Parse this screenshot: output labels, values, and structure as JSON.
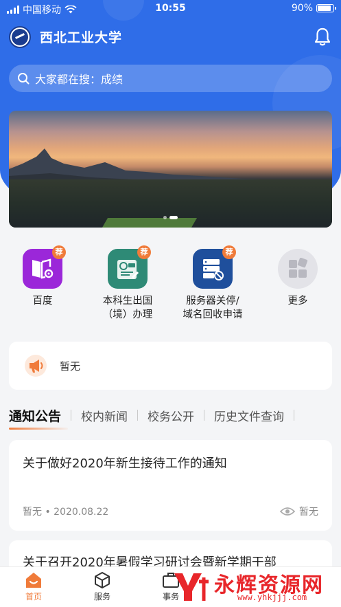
{
  "status_bar": {
    "carrier": "中国移动",
    "time": "10:55",
    "battery": "90%"
  },
  "header": {
    "title": "西北工业大学"
  },
  "search": {
    "text": "大家都在搜：成绩"
  },
  "services": [
    {
      "label": "百度",
      "badge": "荐",
      "icon": "book-gear-icon",
      "color": "#9b27d9"
    },
    {
      "label": "本科生出国（境）办理",
      "badge": "荐",
      "icon": "document-form-icon",
      "color": "#2e8a76"
    },
    {
      "label": "服务器关停/\n域名回收申请",
      "badge": "荐",
      "icon": "server-stop-icon",
      "color": "#1f4f9c"
    },
    {
      "label": "更多",
      "icon": "grid-more-icon",
      "color": "#e3e3e8"
    }
  ],
  "service_labels": {
    "s1": "百度",
    "s2_line1": "本科生出国",
    "s2_line2": "（境）办理",
    "s3_line1": "服务器关停/",
    "s3_line2": "域名回收申请",
    "s4": "更多"
  },
  "notice": {
    "text": "暂无"
  },
  "tabs": [
    "通知公告",
    "校内新闻",
    "校务公开",
    "历史文件查询"
  ],
  "articles": [
    {
      "title": "关于做好2020年新生接待工作的通知",
      "author": "暂无",
      "date": "2020.08.22",
      "meta": "暂无 • 2020.08.22",
      "views": "暂无"
    },
    {
      "title": "关于召开2020年暑假学习研讨会暨新学期干部"
    }
  ],
  "tabbar": {
    "home": "首页",
    "services": "服务",
    "affairs": "事务"
  },
  "watermark": {
    "name": "永辉资源网",
    "url": "www.yhkjjj.com"
  },
  "colors": {
    "primary": "#2f6de8",
    "accent": "#f07b3a"
  }
}
